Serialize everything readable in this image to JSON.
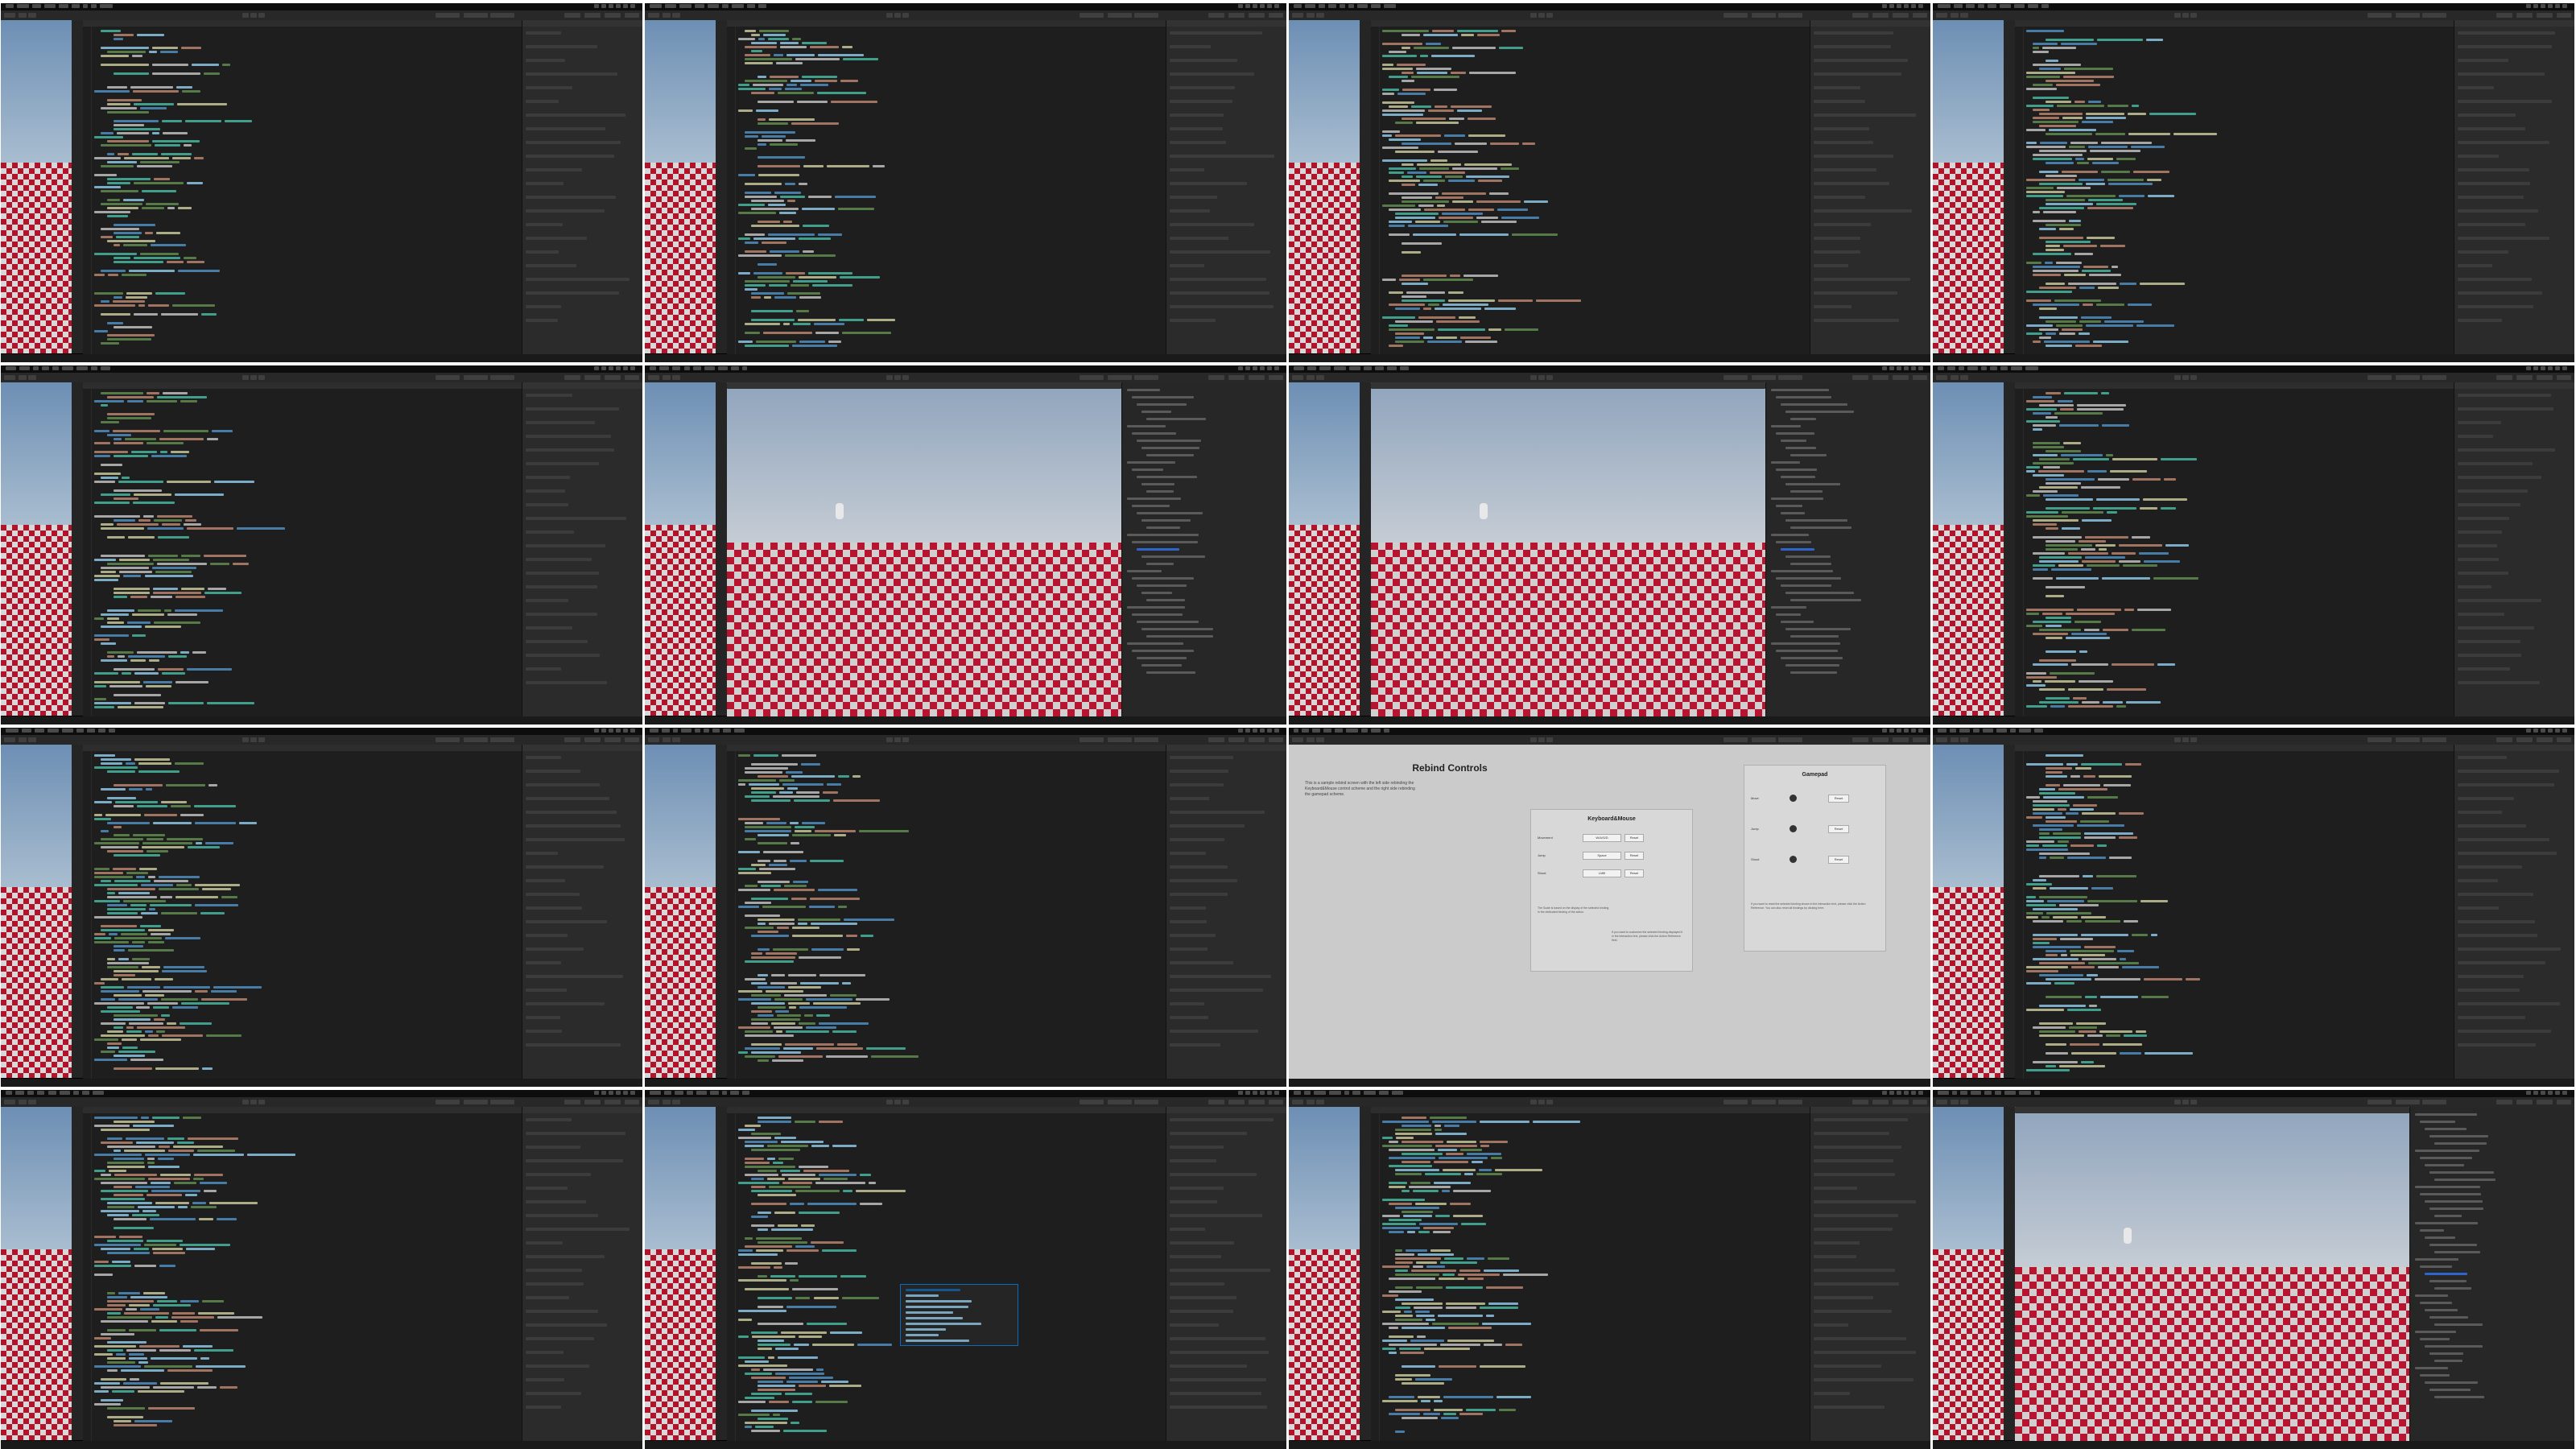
{
  "grid": {
    "rows": 4,
    "cols": 4
  },
  "rebind_screen": {
    "title": "Rebind Controls",
    "intro": "This is a sample rebind screen with the left side rebinding the Keyboard&Mouse control scheme and the right side rebinding the gamepad scheme.",
    "keyboard": {
      "heading": "Keyboard&Mouse",
      "rows": [
        {
          "label": "Movement",
          "value": "W/A/S/D",
          "reset": "Reset"
        },
        {
          "label": "Jump",
          "value": "Space",
          "reset": "Reset"
        },
        {
          "label": "Shoot",
          "value": "LMB",
          "reset": "Reset"
        }
      ],
      "note_left": "The Scale is based on the display of the selected binding in the dedicated binding of the action.",
      "note_right": "If you want to customize the selected binding displayed it in the interaction text, please click the Action Reference field."
    },
    "gamepad": {
      "heading": "Gamepad",
      "rows": [
        {
          "label": "Move",
          "reset": "Reset"
        },
        {
          "label": "Jump",
          "reset": "Reset"
        },
        {
          "label": "Shoot",
          "reset": "Reset"
        }
      ],
      "note": "If you want to reset the selected binding shown in the interaction text, please click the Action Reference. You can also reset all bindings by clicking here."
    }
  },
  "colors": {
    "editor_bg": "#1e1e1e",
    "floor_red": "#b3122b",
    "keyword": "#569cd6",
    "type": "#4ec9b0",
    "string": "#ce9178",
    "comment": "#6a9955",
    "method": "#dcdcaa",
    "plain": "#9cdcfe"
  }
}
